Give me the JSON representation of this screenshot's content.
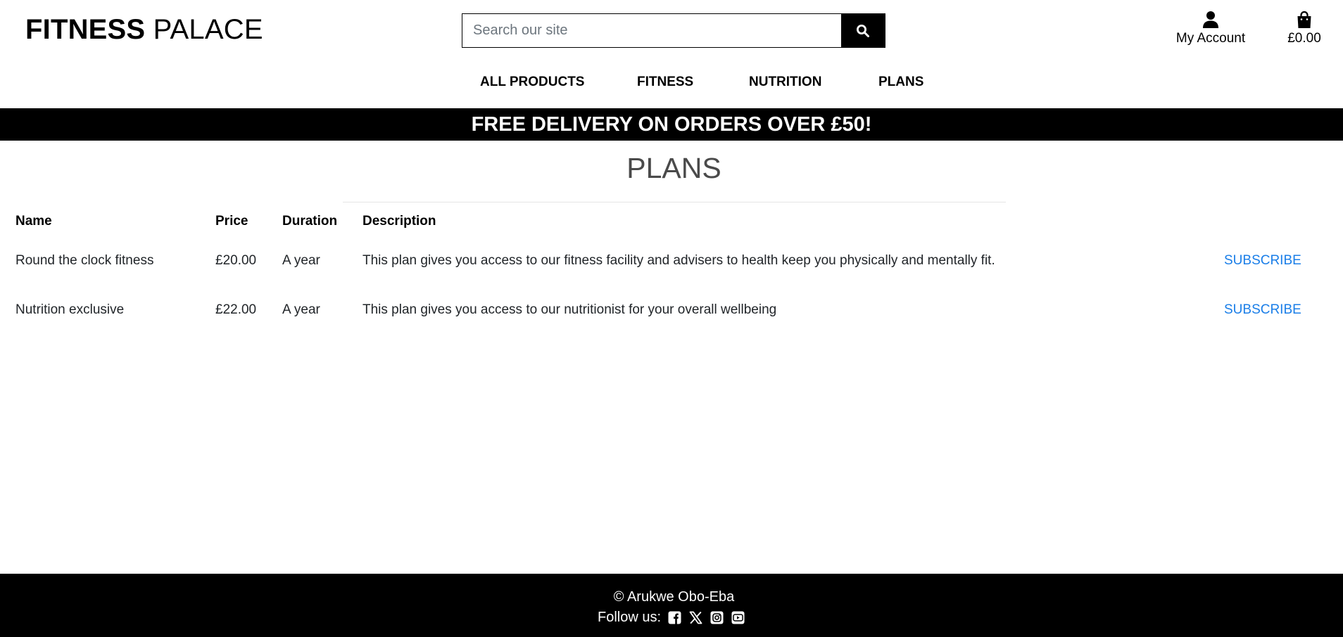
{
  "brand": {
    "part1": "FITNESS",
    "part2": "PALACE"
  },
  "search": {
    "placeholder": "Search our site",
    "value": "",
    "button_icon": "search-icon"
  },
  "account": {
    "label": "My Account",
    "icon": "user-icon"
  },
  "cart": {
    "total": "£0.00",
    "icon": "shopping-bag-icon"
  },
  "nav": {
    "items": [
      "ALL PRODUCTS",
      "FITNESS",
      "NUTRITION",
      "PLANS"
    ]
  },
  "banner": {
    "text": "FREE DELIVERY ON ORDERS OVER £50!"
  },
  "page": {
    "title": "PLANS"
  },
  "table": {
    "headers": [
      "Name",
      "Price",
      "Duration",
      "Description"
    ],
    "rows": [
      {
        "name": "Round the clock fitness",
        "price": "£20.00",
        "duration": "A year",
        "description": "This plan gives you access to our fitness facility and advisers to health keep you physically and mentally fit.",
        "action": "SUBSCRIBE"
      },
      {
        "name": "Nutrition exclusive",
        "price": "£22.00",
        "duration": "A year",
        "description": "This plan gives you access to our nutritionist for your overall wellbeing",
        "action": "SUBSCRIBE"
      }
    ]
  },
  "footer": {
    "copyright": "© Arukwe Obo-Eba",
    "follow_label": "Follow us:",
    "social_icons": [
      "facebook-icon",
      "x-twitter-icon",
      "instagram-icon",
      "youtube-icon"
    ]
  },
  "colors": {
    "accent_link": "#1a7ee8",
    "banner_bg": "#000000",
    "title_gray": "#4a4a4a"
  }
}
